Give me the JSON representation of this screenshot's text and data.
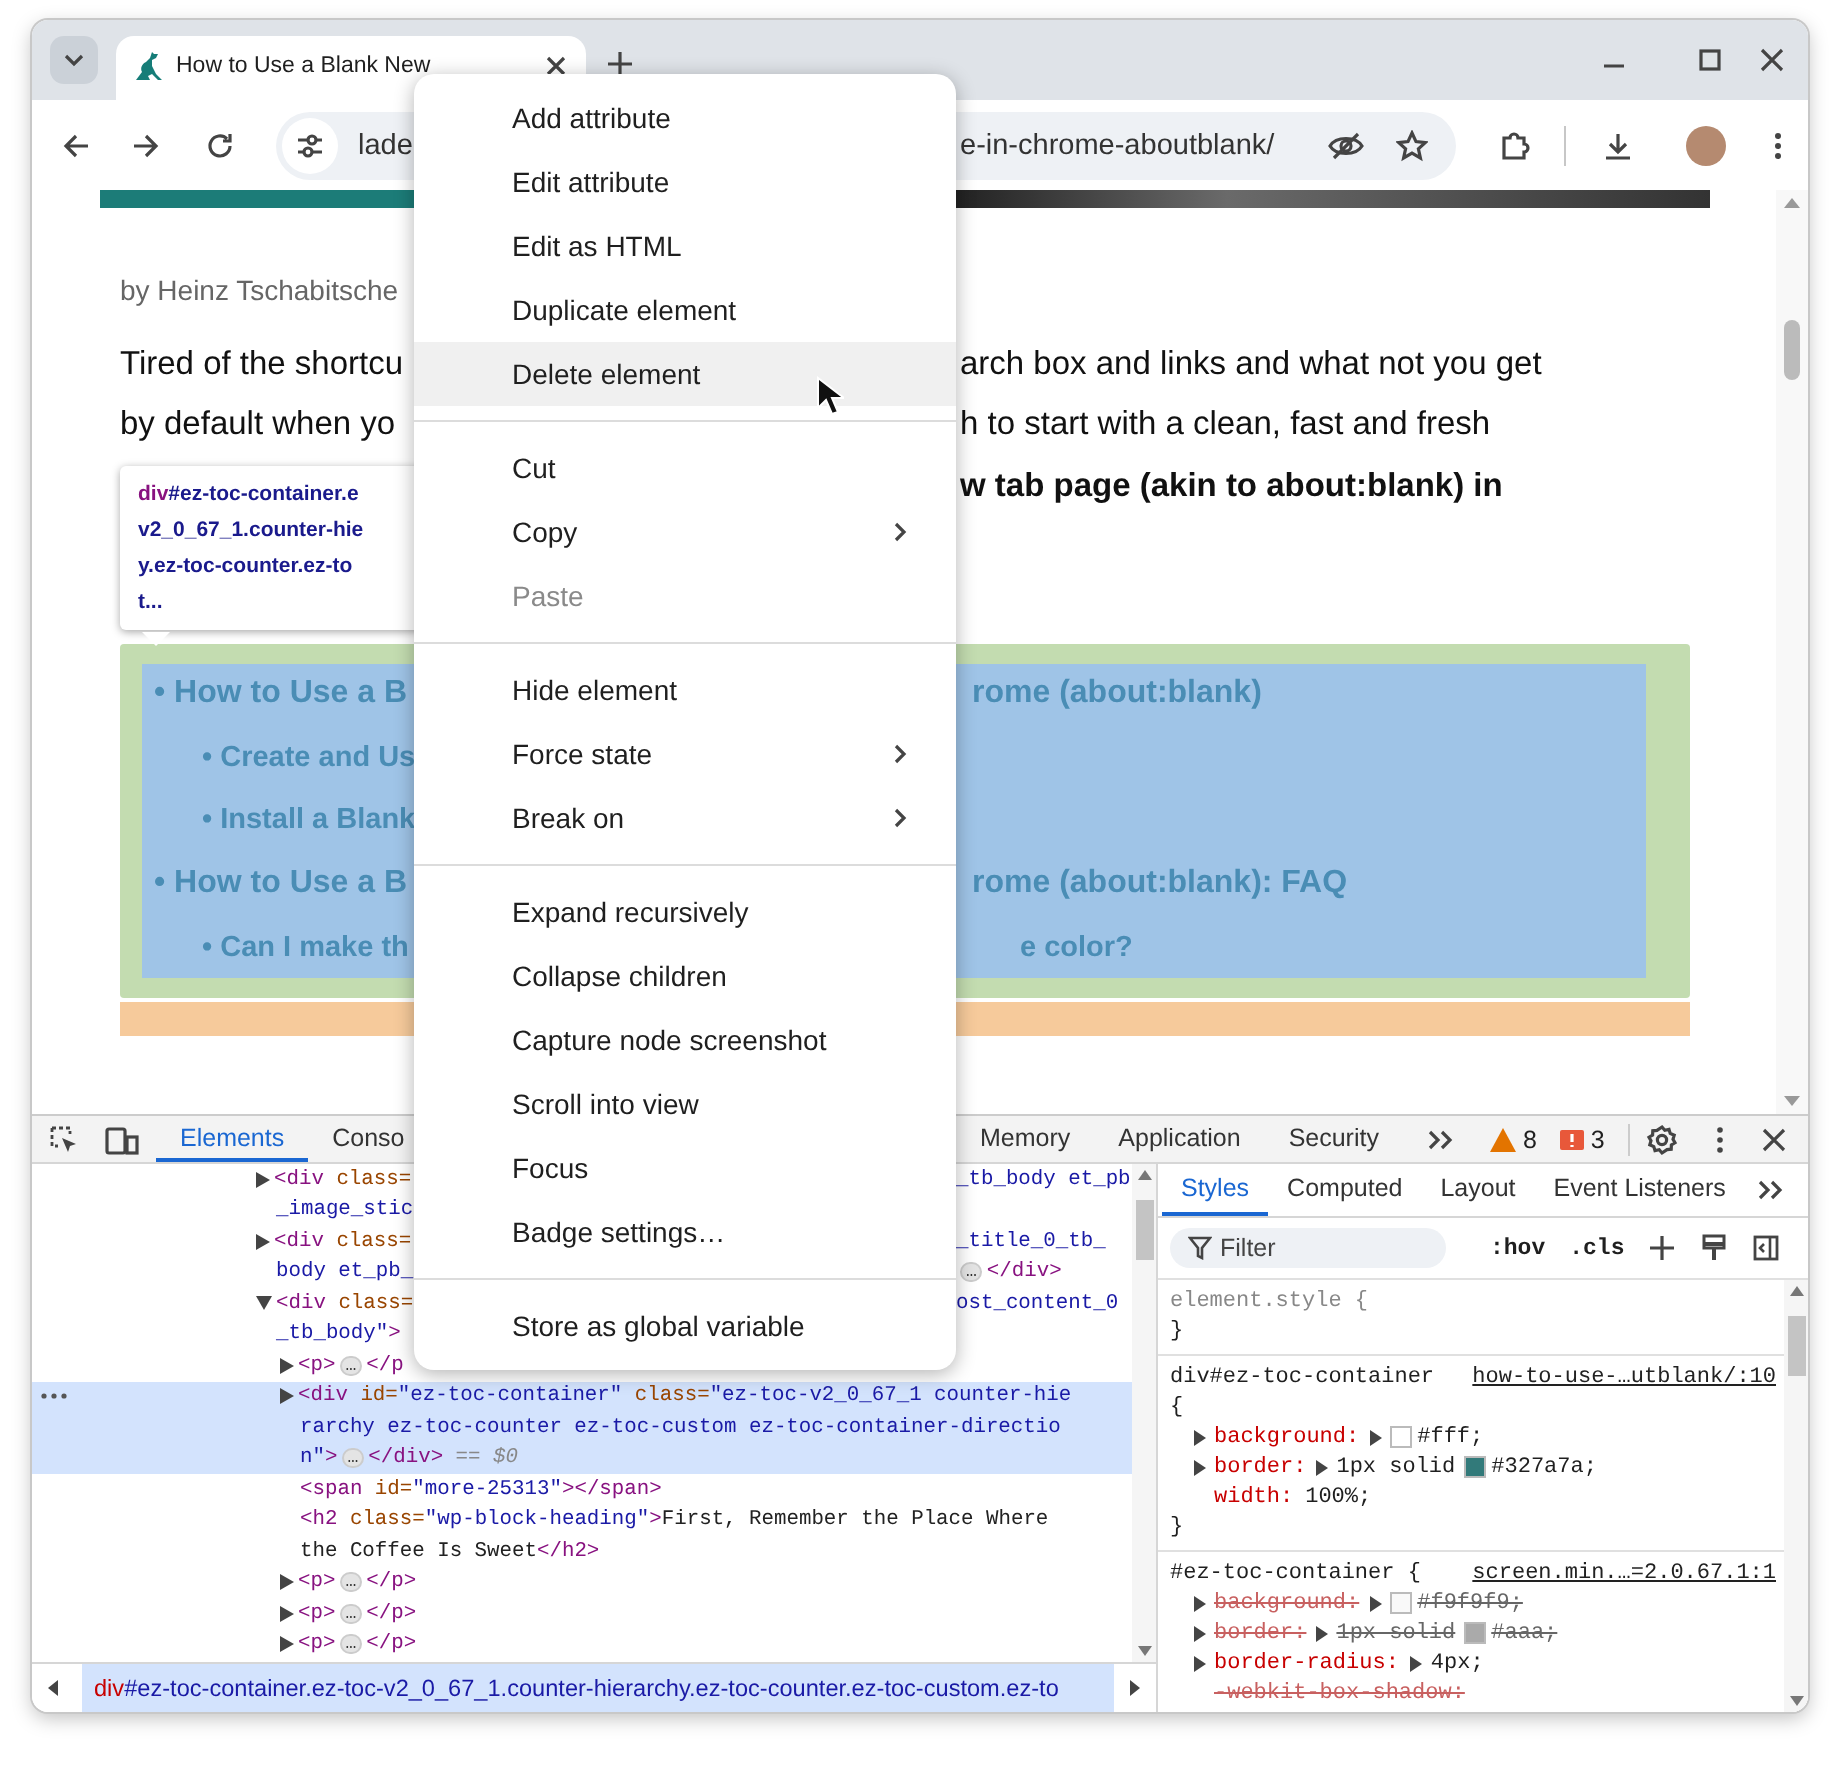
{
  "browser": {
    "tab": {
      "title": "How to Use a Blank New"
    },
    "address": {
      "left": "lade",
      "right": "e-in-chrome-aboutblank/"
    }
  },
  "page": {
    "byline": "by Heinz Tschabitsche",
    "paragraph": [
      {
        "left": "Tired of the shortcu",
        "right": "arch box and links and what not you get",
        "bold": false
      },
      {
        "left": "by default when yo",
        "right": "h to start with a clean, fast and fresh",
        "bold": false
      },
      {
        "right": "w tab page (akin to about:blank) in",
        "bold": true
      }
    ],
    "tooltip": {
      "tag": "div",
      "lines": [
        "#ez-toc-container.e",
        "v2_0_67_1.counter-hie",
        "y.ez-toc-counter.ez-to",
        "t..."
      ]
    },
    "toc": [
      {
        "left": "• How to Use a B",
        "right": "rome (about:blank)",
        "children": [
          {
            "left": "• Create and Us"
          },
          {
            "left": "• Install a Blank"
          }
        ]
      },
      {
        "left": "• How to Use a B",
        "right": "rome (about:blank): FAQ",
        "children": [
          {
            "left": "• Can I make th",
            "right": "e color?"
          }
        ]
      }
    ]
  },
  "context_menu": {
    "items": [
      {
        "kind": "item",
        "label": "Add attribute",
        "highlighted": false,
        "disabled": false
      },
      {
        "kind": "item",
        "label": "Edit attribute",
        "highlighted": false,
        "disabled": false
      },
      {
        "kind": "item",
        "label": "Edit as HTML",
        "highlighted": false,
        "disabled": false
      },
      {
        "kind": "item",
        "label": "Duplicate element",
        "highlighted": false,
        "disabled": false
      },
      {
        "kind": "item",
        "label": "Delete element",
        "highlighted": true,
        "disabled": false
      },
      {
        "kind": "separator"
      },
      {
        "kind": "item",
        "label": "Cut",
        "highlighted": false,
        "disabled": false
      },
      {
        "kind": "submenu",
        "label": "Copy",
        "highlighted": false,
        "disabled": false
      },
      {
        "kind": "item",
        "label": "Paste",
        "highlighted": false,
        "disabled": true
      },
      {
        "kind": "separator"
      },
      {
        "kind": "item",
        "label": "Hide element",
        "highlighted": false,
        "disabled": false
      },
      {
        "kind": "submenu",
        "label": "Force state",
        "highlighted": false,
        "disabled": false
      },
      {
        "kind": "submenu",
        "label": "Break on",
        "highlighted": false,
        "disabled": false
      },
      {
        "kind": "separator"
      },
      {
        "kind": "item",
        "label": "Expand recursively",
        "highlighted": false,
        "disabled": false
      },
      {
        "kind": "item",
        "label": "Collapse children",
        "highlighted": false,
        "disabled": false
      },
      {
        "kind": "item",
        "label": "Capture node screenshot",
        "highlighted": false,
        "disabled": false
      },
      {
        "kind": "item",
        "label": "Scroll into view",
        "highlighted": false,
        "disabled": false
      },
      {
        "kind": "item",
        "label": "Focus",
        "highlighted": false,
        "disabled": false
      },
      {
        "kind": "item",
        "label": "Badge settings…",
        "highlighted": false,
        "disabled": false
      },
      {
        "kind": "separator"
      },
      {
        "kind": "item",
        "label": "Store as global variable",
        "highlighted": false,
        "disabled": false
      }
    ]
  },
  "devtools": {
    "tabs": [
      {
        "label": "Elements",
        "selected": true
      },
      {
        "label": "Conso",
        "selected": false
      },
      {
        "label": "Memory",
        "selected": false
      },
      {
        "label": "Application",
        "selected": false
      },
      {
        "label": "Security",
        "selected": false
      }
    ],
    "warnings": "8",
    "errors": "3",
    "tree": [
      {
        "kind": "collapsed",
        "selected": false,
        "lines": [
          {
            "left": [
              {
                "kind": "tag",
                "text": "<div"
              },
              {
                "kind": "attr",
                "text": " class="
              }
            ],
            "right": [
              {
                "kind": "value",
                "text": "_tb_body et_pb"
              }
            ]
          },
          {
            "left": [
              {
                "kind": "value",
                "text": "_image_stic"
              }
            ]
          }
        ]
      },
      {
        "kind": "collapsed",
        "selected": false,
        "lines": [
          {
            "left": [
              {
                "kind": "tag",
                "text": "<div"
              },
              {
                "kind": "attr",
                "text": " class="
              }
            ],
            "right": [
              {
                "kind": "value",
                "text": "_title_0_tb_"
              }
            ]
          },
          {
            "left": [
              {
                "kind": "value",
                "text": "body et_pb_"
              }
            ],
            "right": [
              {
                "kind": "more",
                "text": "…"
              },
              {
                "kind": "tag",
                "text": "</div>"
              }
            ]
          }
        ]
      },
      {
        "kind": "expanded",
        "selected": false,
        "lines": [
          {
            "left": [
              {
                "kind": "tag",
                "text": "<div"
              },
              {
                "kind": "attr",
                "text": " class="
              }
            ],
            "right": [
              {
                "kind": "value",
                "text": "ost_content_0"
              }
            ]
          },
          {
            "left": [
              {
                "kind": "value",
                "text": "_tb_body\""
              },
              {
                "kind": "tag",
                "text": ">"
              }
            ]
          }
        ],
        "children": [
          {
            "kind": "collapsed",
            "selected": false,
            "lines": [
              {
                "left": [
                  {
                    "kind": "tag",
                    "text": "<p>"
                  },
                  {
                    "kind": "more",
                    "text": "…"
                  },
                  {
                    "kind": "tag",
                    "text": "</p"
                  }
                ]
              }
            ]
          },
          {
            "kind": "collapsed",
            "selected": true,
            "lines": [
              {
                "left": [
                  {
                    "kind": "tag",
                    "text": "<div"
                  },
                  {
                    "kind": "attr",
                    "text": " id="
                  },
                  {
                    "kind": "value",
                    "text": "\"ez-toc-container\""
                  },
                  {
                    "kind": "attr",
                    "text": " class="
                  },
                  {
                    "kind": "value",
                    "text": "\"ez-toc-v2_0_67_1 counter-hie"
                  }
                ]
              },
              {
                "left": [
                  {
                    "kind": "value",
                    "text": "rarchy ez-toc-counter ez-toc-custom ez-toc-container-directio"
                  }
                ]
              },
              {
                "left": [
                  {
                    "kind": "value",
                    "text": "n\""
                  },
                  {
                    "kind": "tag",
                    "text": ">"
                  },
                  {
                    "kind": "more",
                    "text": "…"
                  },
                  {
                    "kind": "tag",
                    "text": "</div>"
                  },
                  {
                    "kind": "dim",
                    "text": " == $0"
                  }
                ]
              }
            ]
          },
          {
            "kind": "leaf",
            "selected": false,
            "lines": [
              {
                "left": [
                  {
                    "kind": "tag",
                    "text": "<span"
                  },
                  {
                    "kind": "attr",
                    "text": " id="
                  },
                  {
                    "kind": "value",
                    "text": "\"more-25313\""
                  },
                  {
                    "kind": "tag",
                    "text": "></span>"
                  }
                ]
              }
            ]
          },
          {
            "kind": "leaf",
            "selected": false,
            "lines": [
              {
                "left": [
                  {
                    "kind": "tag",
                    "text": "<h2"
                  },
                  {
                    "kind": "attr",
                    "text": " class="
                  },
                  {
                    "kind": "value",
                    "text": "\"wp-block-heading\""
                  },
                  {
                    "kind": "tag",
                    "text": ">"
                  },
                  {
                    "kind": "text",
                    "text": "First, Remember the Place Where"
                  }
                ]
              },
              {
                "left": [
                  {
                    "kind": "text",
                    "text": "the Coffee Is Sweet"
                  },
                  {
                    "kind": "tag",
                    "text": "</h2>"
                  }
                ]
              }
            ]
          },
          {
            "kind": "collapsed",
            "selected": false,
            "lines": [
              {
                "left": [
                  {
                    "kind": "tag",
                    "text": "<p>"
                  },
                  {
                    "kind": "more",
                    "text": "…"
                  },
                  {
                    "kind": "tag",
                    "text": "</p>"
                  }
                ]
              }
            ]
          },
          {
            "kind": "collapsed",
            "selected": false,
            "lines": [
              {
                "left": [
                  {
                    "kind": "tag",
                    "text": "<p>"
                  },
                  {
                    "kind": "more",
                    "text": "…"
                  },
                  {
                    "kind": "tag",
                    "text": "</p>"
                  }
                ]
              }
            ]
          },
          {
            "kind": "collapsed",
            "selected": false,
            "lines": [
              {
                "left": [
                  {
                    "kind": "tag",
                    "text": "<p>"
                  },
                  {
                    "kind": "more",
                    "text": "…"
                  },
                  {
                    "kind": "tag",
                    "text": "</p>"
                  }
                ]
              }
            ]
          }
        ]
      }
    ],
    "breadcrumb": {
      "tag": "div",
      "rest": "#ez-toc-container.ez-toc-v2_0_67_1.counter-hierarchy.ez-toc-counter.ez-toc-custom.ez-to"
    },
    "styles": {
      "tabs": [
        {
          "label": "Styles",
          "selected": true
        },
        {
          "label": "Computed",
          "selected": false
        },
        {
          "label": "Layout",
          "selected": false
        },
        {
          "label": "Event Listeners",
          "selected": false
        }
      ],
      "filter": {
        "placeholder": "Filter"
      },
      "hov": ":hov",
      "cls": ".cls",
      "rules": [
        {
          "kind": "inline",
          "selector": "element.style",
          "open": "{",
          "open_on_new_line": false,
          "close": "}"
        },
        {
          "kind": "matched",
          "selector": "div#ez-toc-container",
          "source": "how-to-use-…utblank/:10",
          "open": "{",
          "open_on_new_line": true,
          "close": "}",
          "props": [
            {
              "name": "background:",
              "expandable": true,
              "color": "#ffffff",
              "value": "#fff;",
              "struck": false
            },
            {
              "name": "border:",
              "expandable": true,
              "pre": "1px solid",
              "color": "#327a7a",
              "value": "#327a7a;",
              "struck": false
            },
            {
              "name": "width:",
              "expandable": false,
              "value": "100%;",
              "struck": false
            }
          ]
        },
        {
          "kind": "matched",
          "selector": "#ez-toc-container",
          "source": "screen.min.…=2.0.67.1:1",
          "open": "{",
          "open_on_new_line": false,
          "props": [
            {
              "name": "background:",
              "expandable": true,
              "color": "#f9f9f9",
              "value": "#f9f9f9;",
              "struck": true
            },
            {
              "name": "border:",
              "expandable": true,
              "pre": "1px solid",
              "color": "#aaaaaa",
              "value": "#aaa;",
              "struck": true
            },
            {
              "name": "border-radius:",
              "expandable": true,
              "value": "4px;",
              "struck": false
            },
            {
              "name": "-webkit-box-shadow:",
              "expandable": false,
              "struck": true
            }
          ]
        }
      ]
    }
  }
}
